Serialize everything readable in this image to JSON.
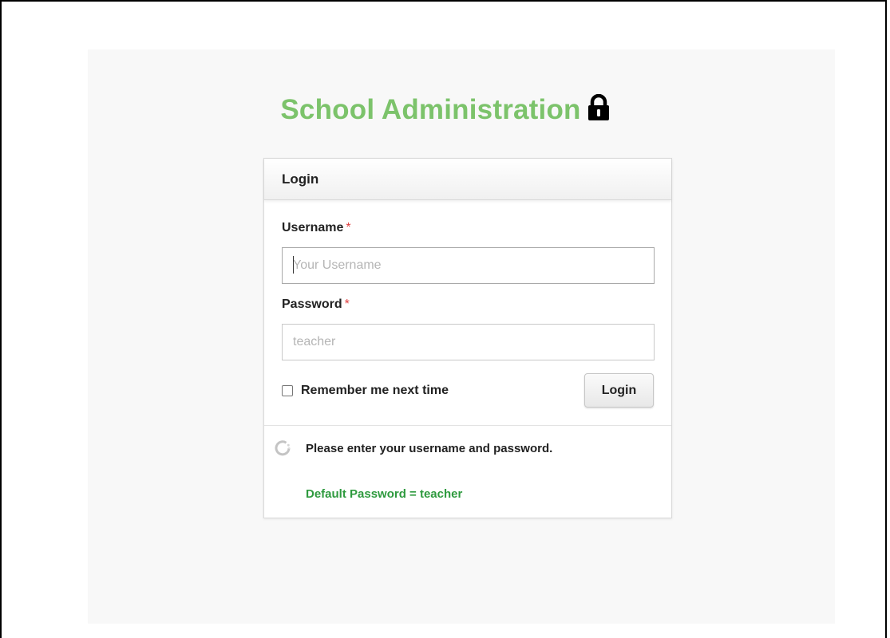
{
  "app": {
    "title": "School Administration",
    "title_color": "#7cc36b",
    "title_icon": "lock-icon"
  },
  "login_form": {
    "header": "Login",
    "username": {
      "label": "Username",
      "required_mark": "*",
      "value": "",
      "placeholder": "Your Username"
    },
    "password": {
      "label": "Password",
      "required_mark": "*",
      "value": "",
      "placeholder": "teacher"
    },
    "remember_me": {
      "label": "Remember me next time",
      "checked": false
    },
    "submit_label": "Login"
  },
  "status": {
    "icon": "spinner-icon",
    "message": "Please enter your username and password."
  },
  "note": {
    "text": "Default Password = teacher",
    "color": "#2e9a3e"
  }
}
